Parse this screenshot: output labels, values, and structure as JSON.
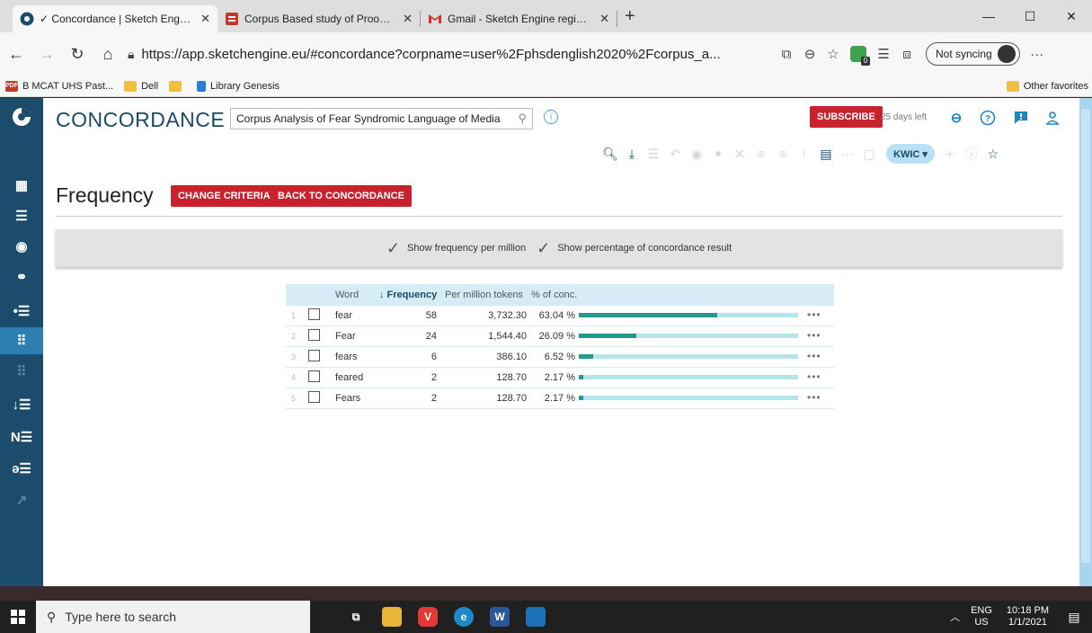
{
  "browser": {
    "tabs": [
      {
        "title": "✓ Concordance | Sketch Engine",
        "close": "✕",
        "active": true
      },
      {
        "title": "Corpus Based study of Proounʷ",
        "close": "✕",
        "active": false
      },
      {
        "title": "Gmail - Sketch Engine registratio",
        "close": "✕",
        "active": false
      }
    ],
    "new_tab": "+",
    "url": "https://app.sketchengine.eu/#concordance?corpname=user%2Fphsdenglish2020%2Fcorpus_a...",
    "sync_label": "Not syncing",
    "bookmarks": [
      "B MCAT UHS Past...",
      "Dell",
      "",
      "Library Genesis"
    ],
    "other_favorites": "Other favorites"
  },
  "app": {
    "title": "CONCORDANCE",
    "corpus": "Corpus Analysis of Fear Syndromic Language of Media",
    "subscribe": "SUBSCRIBE",
    "days_left": "25 days left",
    "view_mode": "KWIC ▾",
    "sidebar_letters": {
      "ne": "N☰",
      "se": "ǝ☰"
    },
    "page_heading": "Frequency",
    "buttons": {
      "change": "CHANGE CRITERIA",
      "back": "BACK TO CONCORDANCE"
    },
    "options": [
      "Show frequency per million",
      "Show percentage of concordance result"
    ],
    "table": {
      "headers": {
        "word": "Word",
        "freq": "↓ Frequency",
        "pm": "Per million tokens",
        "pct": "% of conc."
      },
      "rows": [
        {
          "n": "1",
          "word": "fear",
          "freq": "58",
          "pm": "3,732.30",
          "pct": "63.04 %",
          "share": 63.04
        },
        {
          "n": "2",
          "word": "Fear",
          "freq": "24",
          "pm": "1,544.40",
          "pct": "26.09 %",
          "share": 26.09
        },
        {
          "n": "3",
          "word": "fears",
          "freq": "6",
          "pm": "386.10",
          "pct": "6.52 %",
          "share": 6.52
        },
        {
          "n": "4",
          "word": "feared",
          "freq": "2",
          "pm": "128.70",
          "pct": "2.17 %",
          "share": 2.17
        },
        {
          "n": "5",
          "word": "Fears",
          "freq": "2",
          "pm": "128.70",
          "pct": "2.17 %",
          "share": 2.17
        }
      ],
      "more": "•••"
    }
  },
  "taskbar": {
    "search_placeholder": "Type here to search",
    "lang_top": "ENG",
    "lang_bottom": "US",
    "time": "10:18 PM",
    "date": "1/1/2021"
  },
  "colors": {
    "brand": "#1b4966",
    "accent_red": "#c8222f",
    "bar_fill": "#23998f",
    "bar_track": "#b6e6ea"
  }
}
